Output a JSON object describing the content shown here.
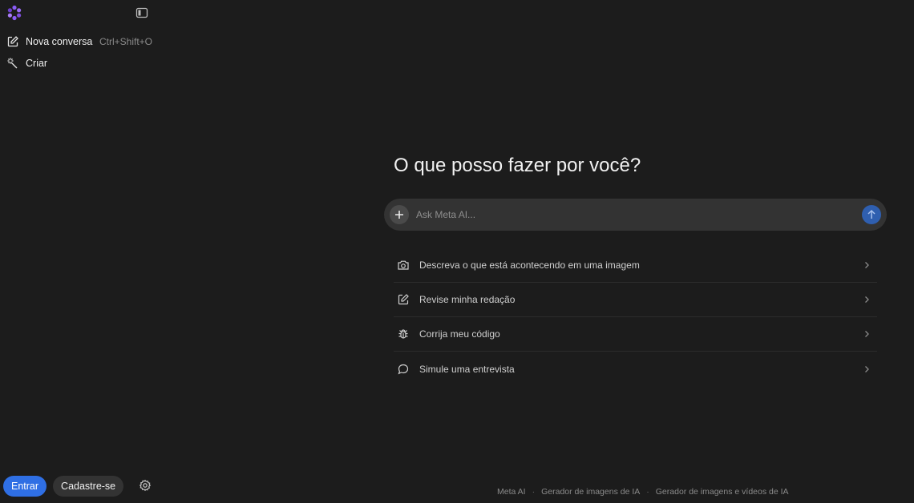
{
  "sidebar": {
    "new_chat_label": "Nova conversa",
    "new_chat_shortcut": "Ctrl+Shift+O",
    "create_label": "Criar",
    "login_label": "Entrar",
    "signup_label": "Cadastre-se"
  },
  "main": {
    "heading": "O que posso fazer por você?",
    "input_placeholder": "Ask Meta AI...",
    "suggestions": [
      {
        "label": "Descreva o que está acontecendo em uma imagem",
        "icon": "camera-icon"
      },
      {
        "label": "Revise minha redação",
        "icon": "edit-icon"
      },
      {
        "label": "Corrija meu código",
        "icon": "bug-icon"
      },
      {
        "label": "Simule uma entrevista",
        "icon": "chat-bubble-icon"
      }
    ]
  },
  "footer": {
    "links": [
      "Meta AI",
      "Gerador de imagens de IA",
      "Gerador de imagens e vídeos de IA"
    ]
  },
  "colors": {
    "background": "#1c1c1c",
    "composer": "#333333",
    "accent_blue": "#2f6fe4",
    "logo_purple": "#8b5cf6"
  }
}
